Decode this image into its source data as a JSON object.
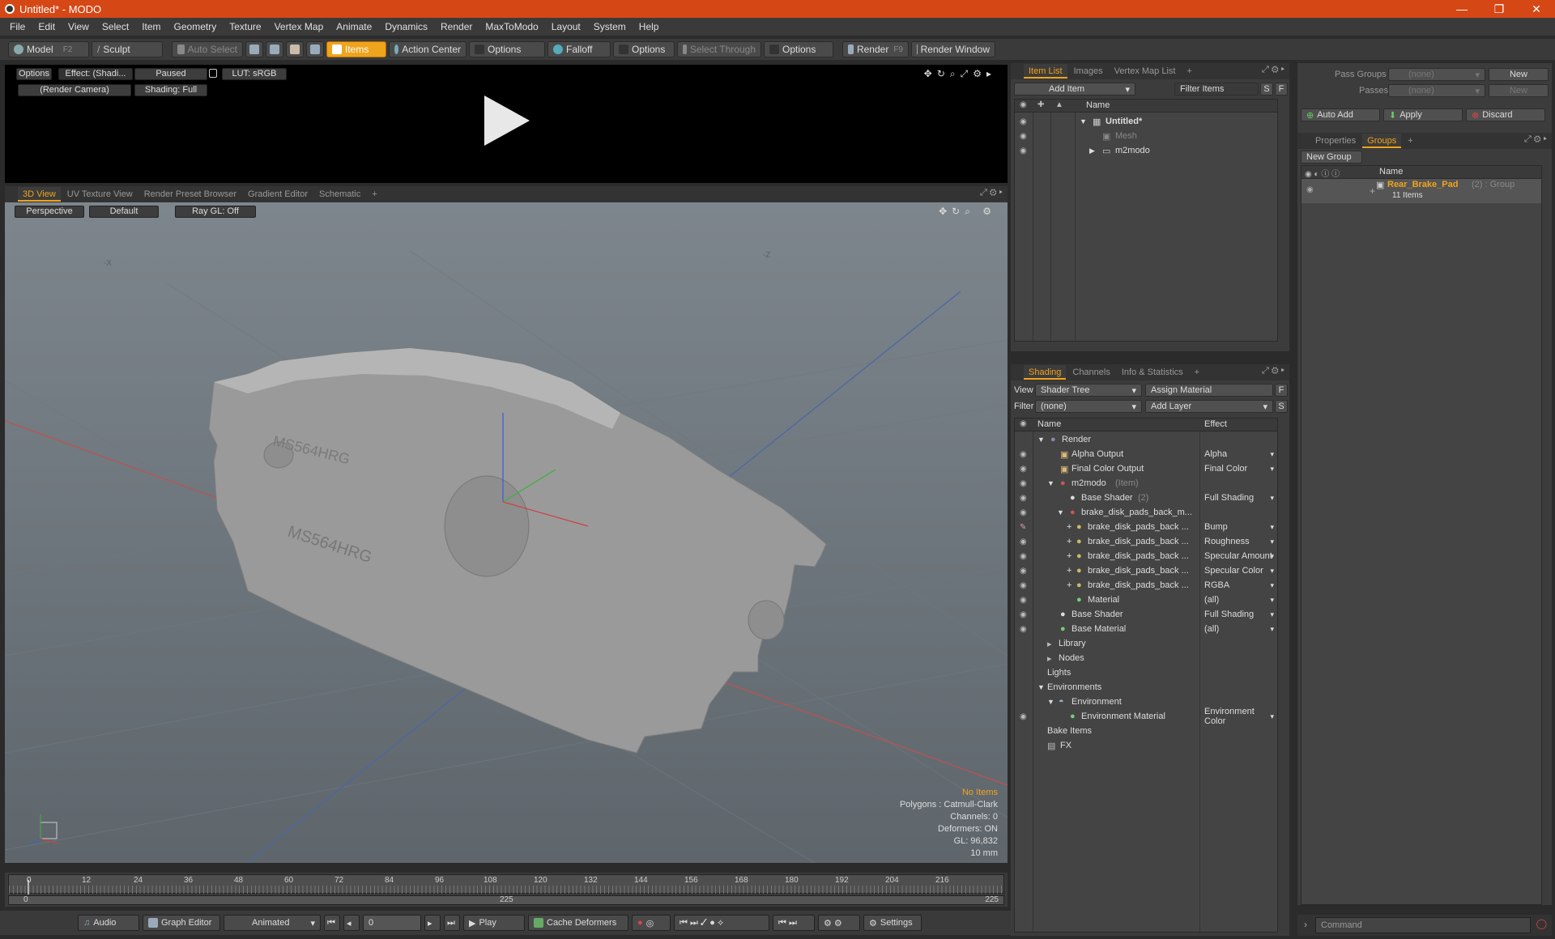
{
  "window": {
    "title": "Untitled* - MODO",
    "minimize": "—",
    "maximize": "❐",
    "close": "✕"
  },
  "menu": [
    "File",
    "Edit",
    "View",
    "Select",
    "Item",
    "Geometry",
    "Texture",
    "Vertex Map",
    "Animate",
    "Dynamics",
    "Render",
    "MaxToModo",
    "Layout",
    "System",
    "Help"
  ],
  "toolbar": {
    "model": "Model",
    "model_key": "F2",
    "sculpt": "Sculpt",
    "auto_select": "Auto Select",
    "items": "Items",
    "action_center": "Action Center",
    "options1": "Options",
    "falloff": "Falloff",
    "options2": "Options",
    "select_through": "Select Through",
    "options3": "Options",
    "render": "Render",
    "render_key": "F9",
    "render_window": "Render Window"
  },
  "preview": {
    "options": "Options",
    "effect": "Effect: (Shadi...",
    "paused": "Paused",
    "lut": "LUT: sRGB",
    "camera": "(Render Camera)",
    "shading": "Shading: Full"
  },
  "viewport_tabs": {
    "tabs": [
      "3D View",
      "UV Texture View",
      "Render Preset Browser",
      "Gradient Editor",
      "Schematic"
    ],
    "add": "+"
  },
  "viewport": {
    "perspective": "Perspective",
    "default": "Default",
    "raygl": "Ray GL: Off",
    "axis_x": "-X",
    "axis_z": "-Z",
    "stats": {
      "no_items": "No Items",
      "polygons": "Polygons : Catmull-Clark",
      "channels": "Channels: 0",
      "deformers": "Deformers: ON",
      "gl": "GL: 96,832",
      "scale": "10 mm"
    },
    "object_text1": "MS564HRG",
    "object_text2": "MS564HRG"
  },
  "timeline": {
    "ticks": [
      "0",
      "12",
      "24",
      "36",
      "48",
      "60",
      "72",
      "84",
      "96",
      "108",
      "120",
      "132",
      "144",
      "156",
      "168",
      "180",
      "192",
      "204",
      "216"
    ],
    "start": "0",
    "mid": "225",
    "end": "225"
  },
  "bottom": {
    "audio": "Audio",
    "graph_editor": "Graph Editor",
    "animated": "Animated",
    "frame": "0",
    "play": "Play",
    "cache": "Cache Deformers",
    "settings": "Settings"
  },
  "item_list": {
    "tabs": [
      "Item List",
      "Images",
      "Vertex Map List"
    ],
    "add_item": "Add Item",
    "filter_items": "Filter Items",
    "s": "S",
    "f": "F",
    "col_name": "Name",
    "rows": [
      {
        "name": "Untitled*"
      },
      {
        "name": "Mesh"
      },
      {
        "name": "m2modo"
      }
    ]
  },
  "groups_panel": {
    "pass_groups_label": "Pass Groups",
    "pass_groups_value": "(none)",
    "new1": "New",
    "passes_label": "Passes",
    "passes_value": "(none)",
    "new2": "New",
    "auto_add": "Auto Add",
    "apply": "Apply",
    "discard": "Discard",
    "tabs": [
      "Properties",
      "Groups"
    ],
    "new_group": "New Group",
    "col_name": "Name",
    "group_name": "Rear_Brake_Pad",
    "group_meta": "(2) : Group",
    "group_count": "11 Items"
  },
  "shading": {
    "tabs": [
      "Shading",
      "Channels",
      "Info & Statistics"
    ],
    "view_label": "View",
    "view_value": "Shader Tree",
    "assign_material": "Assign Material",
    "f": "F",
    "filter_label": "Filter",
    "filter_value": "(none)",
    "add_layer": "Add Layer",
    "s": "S",
    "col_name": "Name",
    "col_effect": "Effect",
    "rows": [
      {
        "name": "Render",
        "effect": ""
      },
      {
        "name": "Alpha Output",
        "effect": "Alpha"
      },
      {
        "name": "Final Color Output",
        "effect": "Final Color"
      },
      {
        "name": "m2modo",
        "suffix": "(Item)",
        "effect": ""
      },
      {
        "name": "Base Shader",
        "suffix": "(2)",
        "effect": "Full Shading"
      },
      {
        "name": "brake_disk_pads_back_m...",
        "effect": ""
      },
      {
        "name": "brake_disk_pads_back ...",
        "effect": "Bump"
      },
      {
        "name": "brake_disk_pads_back ...",
        "effect": "Roughness"
      },
      {
        "name": "brake_disk_pads_back ...",
        "effect": "Specular Amount"
      },
      {
        "name": "brake_disk_pads_back ...",
        "effect": "Specular Color"
      },
      {
        "name": "brake_disk_pads_back ...",
        "effect": "RGBA"
      },
      {
        "name": "Material",
        "effect": "(all)"
      },
      {
        "name": "Base Shader",
        "effect": "Full Shading"
      },
      {
        "name": "Base Material",
        "effect": "(all)"
      },
      {
        "name": "Library",
        "effect": ""
      },
      {
        "name": "Nodes",
        "effect": ""
      },
      {
        "name": "Lights",
        "effect": ""
      },
      {
        "name": "Environments",
        "effect": ""
      },
      {
        "name": "Environment",
        "effect": ""
      },
      {
        "name": "Environment Material",
        "effect": "Environment Color"
      },
      {
        "name": "Bake Items",
        "effect": ""
      },
      {
        "name": "FX",
        "effect": ""
      }
    ]
  },
  "command": {
    "placeholder": "Command"
  },
  "colors": {
    "accent": "#f0a31c",
    "titlebar": "#d64716",
    "group_name": "#f0a31c"
  }
}
